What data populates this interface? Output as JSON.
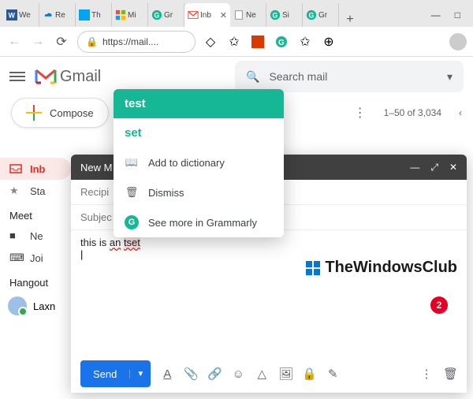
{
  "browser": {
    "tabs": [
      {
        "label": "We"
      },
      {
        "label": "Re"
      },
      {
        "label": "Th"
      },
      {
        "label": "Mi"
      },
      {
        "label": "Gr"
      },
      {
        "label": "Inb",
        "active": true
      },
      {
        "label": "Ne"
      },
      {
        "label": "Si"
      },
      {
        "label": "Gr"
      }
    ],
    "url": "https://mail....",
    "window": {
      "min": "—",
      "max": "□",
      "close": "✕"
    }
  },
  "gmail": {
    "brand": "Gmail",
    "search_placeholder": "Search mail",
    "compose_label": "Compose",
    "page_range": "1–50 of 3,034",
    "sidebar": {
      "inbox": "Inb",
      "starred": "Sta",
      "meet_header": "Meet",
      "join": "Joi",
      "hangouts_header": "Hangout",
      "user": "Laxn"
    }
  },
  "compose": {
    "title": "New M",
    "recipients_label": "Recipi",
    "subject_label": "Subjec",
    "body_prefix": "this is ",
    "body_err1": "an",
    "body_err2": "tset",
    "send_label": "Send",
    "error_count": "2"
  },
  "watermark": {
    "text": "TheWindowsClub"
  },
  "grammarly": {
    "correction": "test",
    "suggestion": "set",
    "add_dict": "Add to dictionary",
    "dismiss": "Dismiss",
    "see_more": "See more in Grammarly"
  }
}
